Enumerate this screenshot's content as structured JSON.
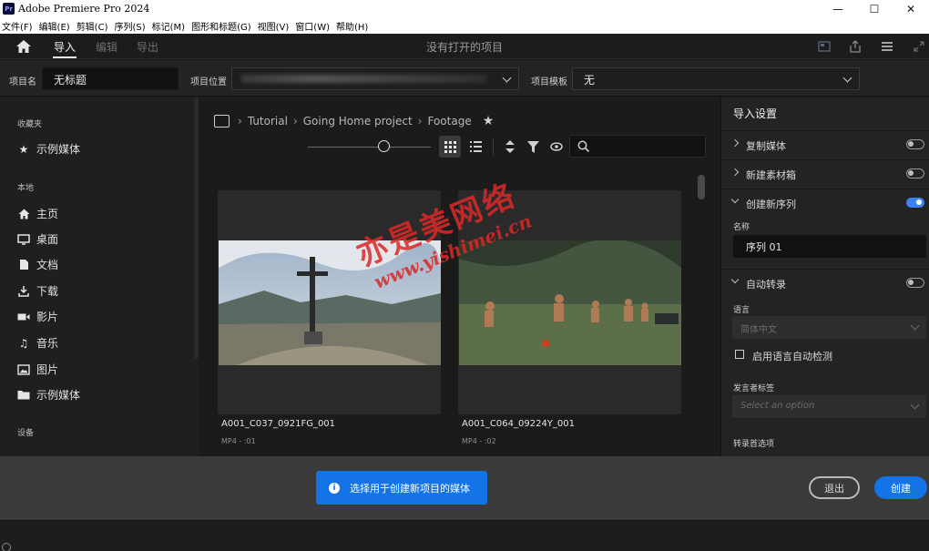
{
  "window": {
    "title": "Adobe Premiere Pro 2024",
    "logo_text": "Pr"
  },
  "menu": [
    "文件(F)",
    "编辑(E)",
    "剪辑(C)",
    "序列(S)",
    "标记(M)",
    "图形和标题(G)",
    "视图(V)",
    "窗口(W)",
    "帮助(H)"
  ],
  "nav": {
    "tabs": [
      "导入",
      "编辑",
      "导出"
    ],
    "active_tab": "导入",
    "center_text": "没有打开的项目"
  },
  "fields": {
    "project_name_label": "项目名",
    "project_name_value": "无标题",
    "location_label": "项目位置",
    "template_label": "项目模板",
    "template_value": "无"
  },
  "sidebar": {
    "favorites_heading": "收藏夹",
    "favorites": [
      {
        "label": "示例媒体",
        "icon": "star-icon"
      }
    ],
    "local_heading": "本地",
    "local": [
      {
        "label": "主页",
        "icon": "home-icon"
      },
      {
        "label": "桌面",
        "icon": "monitor-icon"
      },
      {
        "label": "文档",
        "icon": "document-icon"
      },
      {
        "label": "下载",
        "icon": "download-icon"
      },
      {
        "label": "影片",
        "icon": "video-icon"
      },
      {
        "label": "音乐",
        "icon": "music-icon"
      },
      {
        "label": "图片",
        "icon": "image-icon"
      },
      {
        "label": "示例媒体",
        "icon": "folder-icon"
      }
    ],
    "devices_heading": "设备"
  },
  "browser": {
    "breadcrumb": [
      "Tutorial",
      "Going Home project",
      "Footage"
    ],
    "clips": [
      {
        "name": "A001_C037_0921FG_001",
        "meta": "MP4 - :01"
      },
      {
        "name": "A001_C064_09224Y_001",
        "meta": "MP4 - :02"
      }
    ]
  },
  "import_settings": {
    "title": "导入设置",
    "copy_media": {
      "label": "复制媒体",
      "on": false
    },
    "new_bin": {
      "label": "新建素材箱",
      "on": false
    },
    "new_sequence": {
      "label": "创建新序列",
      "on": true
    },
    "name_label": "名称",
    "name_value": "序列 01",
    "auto_transcribe": {
      "label": "自动转录",
      "on": false
    },
    "language_label": "语言",
    "language_value": "简体中文",
    "auto_detect_label": "启用语言自动检测",
    "speaker_label": "发言者标签",
    "speaker_placeholder": "Select an option",
    "transcribe_pref_label": "转录首选项"
  },
  "bottom": {
    "toast": "选择用于创建新项目的媒体",
    "exit_label": "退出",
    "create_label": "创建"
  },
  "watermark": {
    "line1": "亦是美网络",
    "line2": "www.yishimei.cn"
  },
  "colors": {
    "accent": "#1473e6",
    "toggle_on": "#3b82f6",
    "watermark": "#dc2828"
  }
}
